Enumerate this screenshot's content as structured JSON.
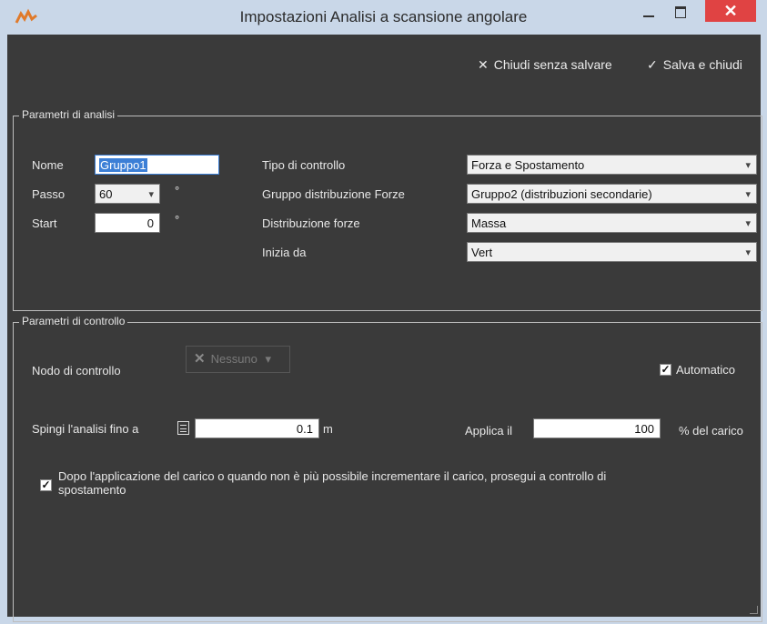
{
  "window": {
    "title": "Impostazioni Analisi a scansione angolare",
    "close_glyph": "✕"
  },
  "toolbar": {
    "close_without_save": "Chiudi senza salvare",
    "save_and_close": "Salva e chiudi"
  },
  "analysis_params": {
    "legend": "Parametri di analisi",
    "name_label": "Nome",
    "name_value": "Gruppo1",
    "step_label": "Passo",
    "step_value": "60",
    "step_unit": "°",
    "start_label": "Start",
    "start_value": "0",
    "start_unit": "°",
    "control_type_label": "Tipo di controllo",
    "control_type_value": "Forza e Spostamento",
    "force_group_label": "Gruppo distribuzione Forze",
    "force_group_value": "Gruppo2 (distribuzioni secondarie)",
    "force_dist_label": "Distribuzione forze",
    "force_dist_value": "Massa",
    "start_from_label": "Inizia da",
    "start_from_value": "Vert"
  },
  "control_params": {
    "legend": "Parametri di controllo",
    "node_label": "Nodo di controllo",
    "node_value": "Nessuno",
    "automatic_label": "Automatico",
    "automatic_checked": true,
    "push_label": "Spingi l'analisi fino a",
    "push_value": "0.1",
    "push_unit": "m",
    "apply_label": "Applica il",
    "apply_value": "100",
    "apply_unit": "% del carico",
    "continue_line1": "Dopo l'applicazione del carico o quando non è più possibile incrementare il carico, prosegui a controllo di",
    "continue_line2": "spostamento",
    "continue_checked": true
  },
  "colors": {
    "background": "#3a3a3a",
    "titlebar": "#c9d7e8",
    "close_button": "#e04343",
    "selection": "#3c7fd6"
  },
  "icons": [
    "app-logo-icon",
    "minimize-icon",
    "maximize-icon",
    "close-icon",
    "cross-icon",
    "checkmark-icon",
    "chevron-down-icon",
    "calculator-icon",
    "checkbox-icon"
  ]
}
